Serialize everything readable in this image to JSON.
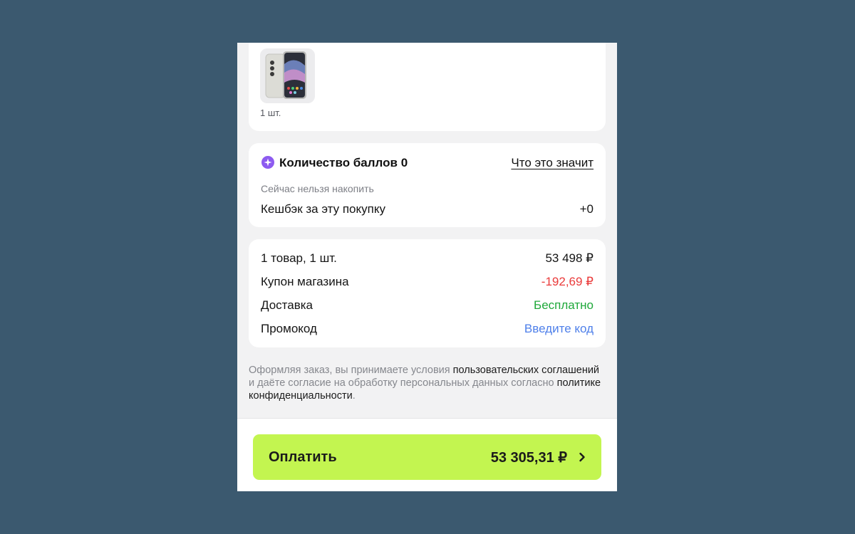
{
  "product": {
    "quantity": "1 шт."
  },
  "points": {
    "title": "Количество баллов 0",
    "info_link": "Что это значит",
    "cannot_accumulate": "Сейчас нельзя накопить",
    "cashback_label": "Кешбэк за эту покупку",
    "cashback_value": "+0"
  },
  "summary": {
    "items_label": "1 товар, 1 шт.",
    "items_value": "53 498 ₽",
    "coupon_label": "Купон магазина",
    "coupon_value": "-192,69 ₽",
    "delivery_label": "Доставка",
    "delivery_value": "Бесплатно",
    "promo_label": "Промокод",
    "promo_value": "Введите код"
  },
  "legal": {
    "part1": "Оформляя заказ, вы принимаете условия ",
    "link1": "пользовательских соглашений",
    "part2": " и даёте согласие на обработку персональных данных согласно ",
    "link2": "политике конфиденциальности",
    "part3": "."
  },
  "pay": {
    "label": "Оплатить",
    "amount": "53 305,31 ₽"
  },
  "icons": {
    "points": "sparkle-icon",
    "pay_arrow": "chevron-right-icon"
  },
  "colors": {
    "background": "#3b596f",
    "pay_button": "#c3f550",
    "coupon": "#ea3b3b",
    "delivery": "#1fa83a",
    "promo": "#4f80ea",
    "points_icon": "#8d5bf0"
  }
}
